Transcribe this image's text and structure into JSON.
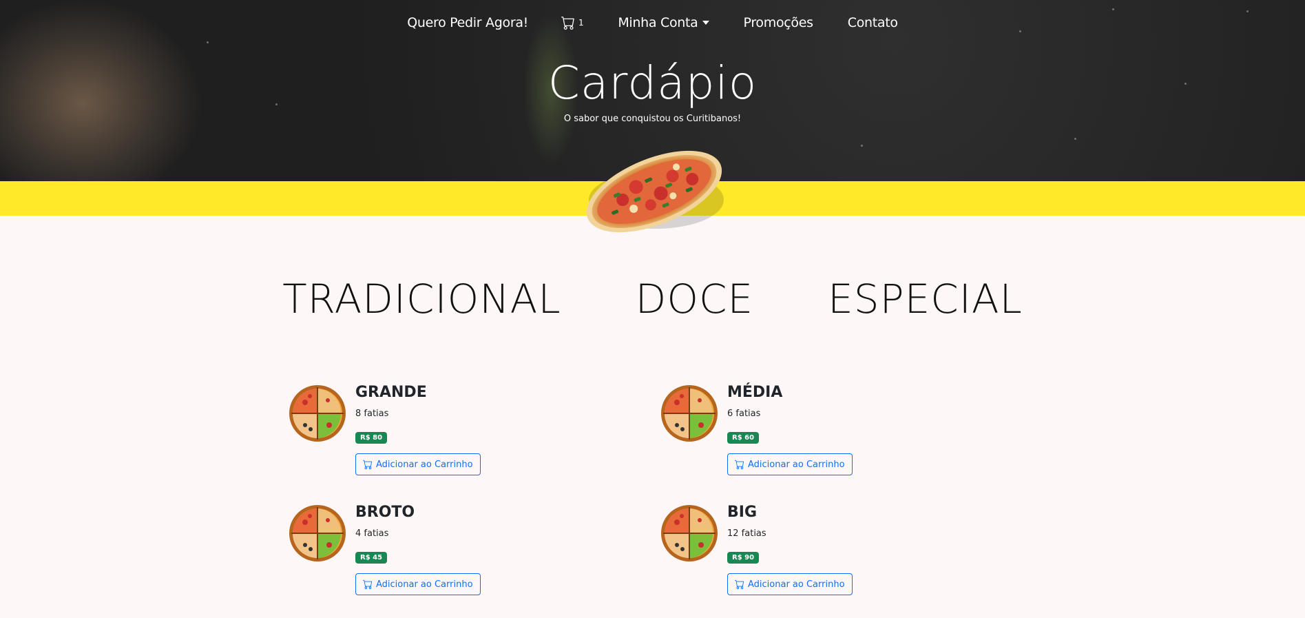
{
  "nav": {
    "order_now": "Quero Pedir Agora!",
    "cart_count": "1",
    "account": "Minha Conta",
    "promotions": "Promoções",
    "contact": "Contato"
  },
  "hero": {
    "title": "Cardápio",
    "subtitle": "O sabor que conquistou os Curitibanos!"
  },
  "categories": [
    "TRADICIONAL",
    "DOCE",
    "ESPECIAL"
  ],
  "products": [
    {
      "name": "GRANDE",
      "slices": "8 fatias",
      "price": "R$ 80",
      "button": "Adicionar ao Carrinho"
    },
    {
      "name": "MÉDIA",
      "slices": "6 fatias",
      "price": "R$ 60",
      "button": "Adicionar ao Carrinho"
    },
    {
      "name": "BROTO",
      "slices": "4 fatias",
      "price": "R$ 45",
      "button": "Adicionar ao Carrinho"
    },
    {
      "name": "BIG",
      "slices": "12 fatias",
      "price": "R$ 90",
      "button": "Adicionar ao Carrinho"
    }
  ],
  "colors": {
    "band": "#ffe928",
    "price_badge": "#198754",
    "button": "#0d6efd",
    "page_bg": "#fdf8f7"
  },
  "icons": {
    "cart": "cart-icon",
    "pizza": "pizza-icon"
  }
}
